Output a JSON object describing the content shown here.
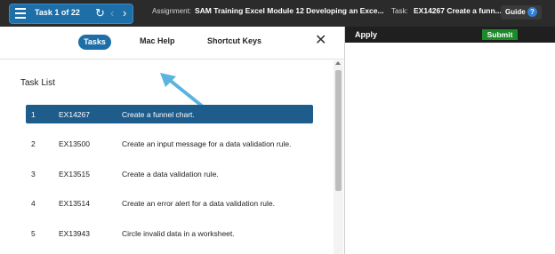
{
  "topbar": {
    "task_counter": "Task 1 of 22",
    "reset_glyph": "↻",
    "prev_glyph": "‹",
    "next_glyph": "›",
    "assignment_label": "Assignment:",
    "assignment_name": "SAM Training Excel Module 12 Developing an Exce...",
    "task_label": "Task:",
    "task_name": "EX14267 Create a funn...",
    "guide_label": "Guide",
    "help_glyph": "?"
  },
  "panel": {
    "tabs": [
      {
        "label": "Tasks",
        "active": true
      },
      {
        "label": "Mac Help",
        "active": false
      },
      {
        "label": "Shortcut Keys",
        "active": false
      }
    ],
    "close_glyph": "✕",
    "task_list_title": "Task List",
    "tasks": [
      {
        "num": "1",
        "code": "EX14267",
        "desc": "Create a funnel chart.",
        "selected": true
      },
      {
        "num": "2",
        "code": "EX13500",
        "desc": "Create an input message for a data validation rule.",
        "selected": false
      },
      {
        "num": "3",
        "code": "EX13515",
        "desc": "Create a data validation rule.",
        "selected": false
      },
      {
        "num": "4",
        "code": "EX13514",
        "desc": "Create an error alert for a data validation rule.",
        "selected": false
      },
      {
        "num": "5",
        "code": "EX13943",
        "desc": "Circle invalid data in a worksheet.",
        "selected": false
      }
    ]
  },
  "right": {
    "apply_label": "Apply",
    "submit_label": "Submit"
  },
  "colors": {
    "accent_blue": "#1e6fa8",
    "selected_row": "#1e5c8c",
    "submit_green": "#1a8a2b",
    "annotation_arrow": "#5ab4e0",
    "topbar_bg": "#2b2b2b"
  }
}
